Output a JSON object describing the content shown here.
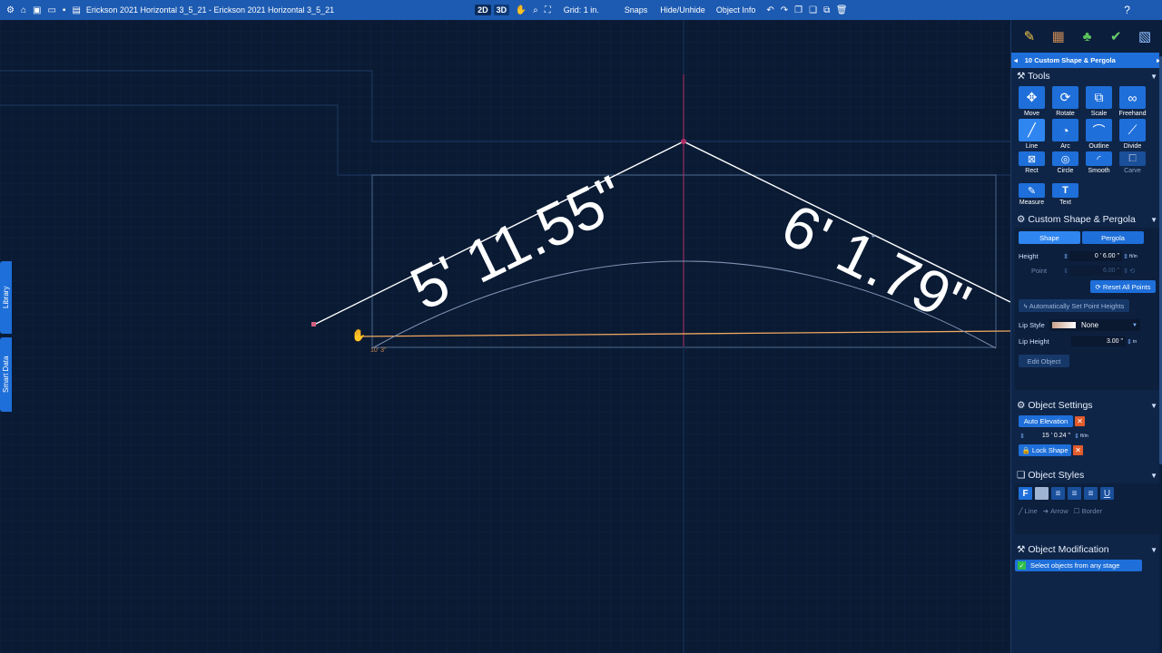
{
  "titlebar": {
    "doc_title": "Erickson 2021 Horizontal 3_5_21 - Erickson 2021 Horizontal 3_5_21",
    "mode_2d": "2D",
    "mode_3d": "3D",
    "grid": "Grid: 1 in.",
    "snaps": "Snaps",
    "hide_unhide": "Hide/Unhide",
    "object_info": "Object Info",
    "help": "?"
  },
  "canvas": {
    "dim_left": "5' 11.55\"",
    "dim_right": "6' 1.79\"",
    "small_dim": "10' 3\""
  },
  "side_tabs": {
    "library": "Library",
    "smart_data": "Smart Data"
  },
  "panel": {
    "stage": "10 Custom Shape & Pergola",
    "tools_title": "Tools",
    "tools": [
      {
        "label": "Move",
        "icon": "move-icon",
        "glyph": "✥"
      },
      {
        "label": "Rotate",
        "icon": "rotate-icon",
        "glyph": "⟳"
      },
      {
        "label": "Scale",
        "icon": "scale-icon",
        "glyph": "⧉"
      },
      {
        "label": "Freehand",
        "icon": "freehand-icon",
        "glyph": "∞"
      },
      {
        "label": "Line",
        "icon": "line-icon",
        "glyph": "╱"
      },
      {
        "label": "Arc",
        "icon": "arc-icon",
        "glyph": "◔"
      },
      {
        "label": "Outline",
        "icon": "outline-icon",
        "glyph": "⌒"
      },
      {
        "label": "Divide",
        "icon": "divide-icon",
        "glyph": "⟋"
      },
      {
        "label": "Rect",
        "icon": "rect-icon",
        "glyph": "⊠"
      },
      {
        "label": "Circle",
        "icon": "circle-icon",
        "glyph": "◎"
      },
      {
        "label": "Smooth",
        "icon": "smooth-icon",
        "glyph": "◜"
      },
      {
        "label": "Carve",
        "icon": "carve-icon",
        "glyph": "⧠"
      },
      {
        "label": "Measure",
        "icon": "measure-icon",
        "glyph": "✎"
      },
      {
        "label": "Text",
        "icon": "text-icon",
        "glyph": "T"
      }
    ],
    "custom_shape": {
      "title": "Custom Shape & Pergola",
      "tab_shape": "Shape",
      "tab_pergola": "Pergola",
      "height_label": "Height",
      "height_value": "0 ' 6.00 \"",
      "height_unit": "ft/in",
      "point_label": "Point",
      "point_value": "6.00 \"",
      "reset_all": "Reset All Points",
      "auto_set": "Automatically Set Point Heights",
      "lip_style_label": "Lip Style",
      "lip_style_value": "None",
      "lip_height_label": "Lip Height",
      "lip_height_value": "3.00 \"",
      "lip_height_unit": "in",
      "edit_object": "Edit Object"
    },
    "object_settings": {
      "title": "Object Settings",
      "auto_elevation": "Auto Elevation",
      "elevation_value": "15 ' 0.24 \"",
      "elevation_unit": "ft/in",
      "lock_shape": "Lock Shape"
    },
    "object_styles": {
      "title": "Object Styles",
      "line": "Line",
      "arrow": "Arrow",
      "border": "Border"
    },
    "object_modification": {
      "title": "Object Modification",
      "select_any_stage": "Select objects from any stage"
    }
  }
}
